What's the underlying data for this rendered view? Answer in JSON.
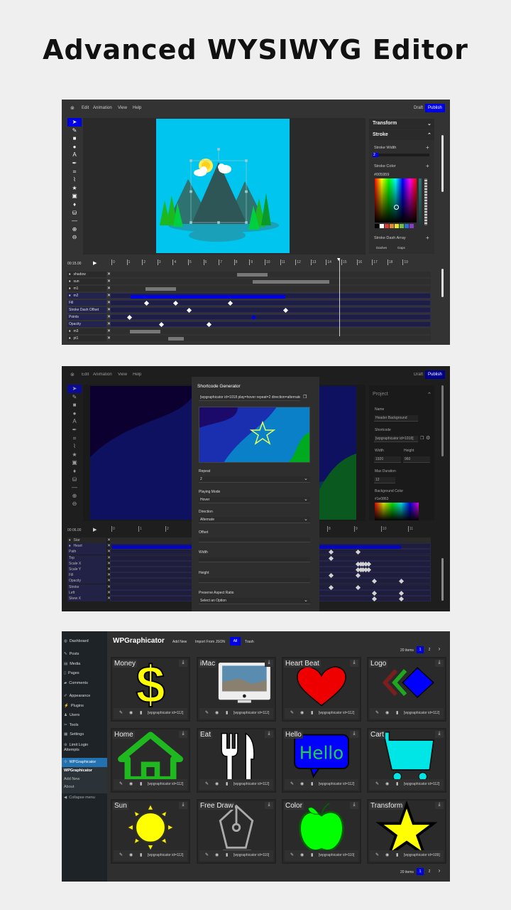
{
  "hero_title": "Advanced WYSIWYG Editor",
  "colors": {
    "accent": "#0000e6",
    "artboard1": "#00c5ee",
    "wp_sidebar": "#1d2327",
    "wp_active": "#2271b1"
  },
  "editor1": {
    "menu": [
      "Edit",
      "Animation",
      "View",
      "Help"
    ],
    "draft": "Draft",
    "publish": "Publish",
    "tools": [
      "select-icon",
      "pencil-icon",
      "rectangle-icon",
      "circle-icon",
      "text-icon",
      "pen-icon",
      "crop-icon",
      "path-icon",
      "star-icon",
      "image-icon",
      "drop-icon",
      "paint-bucket-icon",
      "line-icon",
      "zoom-in-icon",
      "zoom-out-icon"
    ],
    "panel": {
      "transform": "Transform",
      "stroke": "Stroke",
      "stroke_width_label": "Stroke Width",
      "stroke_width_value": "2",
      "stroke_color_label": "Stroke Color",
      "stroke_color_value": "#005959",
      "swatches": [
        "#000000",
        "#ffffff",
        "#d63a3a",
        "#e08a2a",
        "#e8e030",
        "#6ac040",
        "#2a70d0",
        "#8a3ad0"
      ],
      "stroke_dash_label": "Stroke Dash Array",
      "dashes": "Dashes",
      "gaps": "Gaps"
    },
    "timeline": {
      "time": "00:15.00",
      "ticks": [
        "0",
        "1",
        "2",
        "3",
        "4",
        "5",
        "6",
        "7",
        "8",
        "9",
        "10",
        "11",
        "12",
        "13",
        "14",
        "15",
        "16",
        "17",
        "18",
        "19"
      ],
      "playhead": 14.8,
      "rows": [
        {
          "name": "shadow",
          "layer": true,
          "bars": [
            [
              8.2,
              10.2
            ]
          ]
        },
        {
          "name": "sun",
          "layer": true,
          "bars": [
            [
              9.2,
              14.2
            ]
          ]
        },
        {
          "name": "m1",
          "layer": true,
          "bars": [
            [
              2.2,
              4.2
            ]
          ]
        },
        {
          "name": "m2",
          "layer": true,
          "selected": true,
          "bars": [
            [
              1.2,
              11.3
            ]
          ],
          "bar_color": "#0000e6"
        },
        {
          "name": "Fill",
          "prop": true,
          "keys": [
            2.2,
            4.1,
            7.7
          ]
        },
        {
          "name": "Stroke Dash Offset",
          "prop": true,
          "keys": [
            5.0,
            11.3
          ]
        },
        {
          "name": "Points",
          "prop": true,
          "keys": [
            1.1,
            9.2
          ],
          "active_key": 9.2
        },
        {
          "name": "Opacity",
          "prop": true,
          "keys": [
            3.2,
            6.3
          ]
        },
        {
          "name": "m3",
          "layer": true,
          "bars": [
            [
              1.2,
              3.2
            ]
          ]
        },
        {
          "name": "pt1",
          "layer": true,
          "bars": [
            [
              3.7,
              4.7
            ]
          ]
        }
      ]
    }
  },
  "editor2": {
    "menu": [
      "Edit",
      "Animation",
      "View",
      "Help"
    ],
    "draft": "Draft",
    "publish": "Publish",
    "modal": {
      "title": "Shortcode Generator",
      "shortcode": "[wpgraphicator id=1018 play=hover repeat=2 direction=alternate]",
      "repeat_label": "Repeat",
      "repeat_value": "2",
      "mode_label": "Playing Mode",
      "mode_value": "Hover",
      "direction_label": "Direction",
      "direction_value": "Alternate",
      "offset_label": "Offset",
      "width_label": "Width",
      "height_label": "Height",
      "aspect_label": "Preserve Aspect Ratio",
      "aspect_value": "Select an Option"
    },
    "project": {
      "title": "Project",
      "name_label": "Name",
      "name_value": "Header Background",
      "shortcode_label": "Shortcode",
      "shortcode_value": "[wpgraphicator id=1018]",
      "width_label": "Width",
      "width_value": "1920",
      "height_label": "Height",
      "height_value": "960",
      "duration_label": "Max Duration",
      "duration_value": "12",
      "bg_label": "Background Color",
      "bg_value": "#1e0863"
    },
    "timeline": {
      "time": "00:06.00",
      "ticks": [
        "0",
        "1",
        "2",
        "3",
        "4",
        "5",
        "6",
        "7",
        "8",
        "9",
        "10",
        "11"
      ],
      "rows": [
        {
          "name": "Star",
          "layer": true
        },
        {
          "name": "Heart",
          "layer": true,
          "selected": true,
          "bars": [
            [
              0,
              10.7
            ]
          ],
          "bar_color": "#0000e6"
        },
        {
          "name": "Path",
          "prop": true,
          "keys": [
            8.1,
            9.1
          ]
        },
        {
          "name": "Top",
          "prop": true,
          "keys": [
            8.1
          ]
        },
        {
          "name": "Scale X",
          "prop": true,
          "keys": [
            9.1,
            9.2,
            9.3,
            9.4,
            9.5
          ]
        },
        {
          "name": "Scale Y",
          "prop": true,
          "keys": [
            9.1,
            9.2,
            9.3,
            9.4,
            9.5
          ]
        },
        {
          "name": "Fill",
          "prop": true,
          "keys": [
            8.1,
            9.1
          ]
        },
        {
          "name": "Opacity",
          "prop": true,
          "keys": [
            9.7,
            10.7
          ]
        },
        {
          "name": "Stroke",
          "prop": true,
          "keys": [
            8.1,
            9.1
          ]
        },
        {
          "name": "Left",
          "prop": true,
          "keys": [
            9.7,
            10.7
          ]
        },
        {
          "name": "Skew X",
          "prop": true,
          "keys": [
            9.7,
            10.7
          ]
        }
      ]
    }
  },
  "wp": {
    "menu": [
      {
        "label": "Dashboard",
        "icon": "dashboard-icon"
      },
      {
        "label": "Posts",
        "icon": "pin-icon"
      },
      {
        "label": "Media",
        "icon": "media-icon"
      },
      {
        "label": "Pages",
        "icon": "pages-icon"
      },
      {
        "label": "Comments",
        "icon": "comment-icon"
      },
      {
        "label": "Appearance",
        "icon": "brush-icon"
      },
      {
        "label": "Plugins",
        "icon": "plugin-icon"
      },
      {
        "label": "Users",
        "icon": "user-icon"
      },
      {
        "label": "Tools",
        "icon": "wrench-icon"
      },
      {
        "label": "Settings",
        "icon": "settings-icon"
      },
      {
        "label": "Limit Login Attempts",
        "icon": "lock-icon"
      },
      {
        "label": "WPGraphicator",
        "icon": "graphicator-icon",
        "active": true
      }
    ],
    "submenu": [
      "WPGraphicator",
      "Add New",
      "About"
    ],
    "collapse": "Collapse menu",
    "title": "WPGraphicator",
    "actions": [
      "Add New",
      "Import From JSON"
    ],
    "filters": [
      "All",
      "Trash"
    ],
    "items_count": "20 items",
    "pages": [
      "1",
      "2"
    ],
    "next": "›",
    "cards": [
      {
        "title": "Money",
        "icon": "dollar",
        "shortcode": "[wpgraphicator id=112]"
      },
      {
        "title": "iMac",
        "icon": "imac",
        "shortcode": "[wpgraphicator id=112]"
      },
      {
        "title": "Heart Beat",
        "icon": "heart",
        "shortcode": "[wpgraphicator id=112]"
      },
      {
        "title": "Logo",
        "icon": "logo",
        "shortcode": "[wpgraphicator id=112]"
      },
      {
        "title": "Home",
        "icon": "house",
        "shortcode": "[wpgraphicator id=112]"
      },
      {
        "title": "Eat",
        "icon": "fork-knife",
        "shortcode": "[wpgraphicator id=112]"
      },
      {
        "title": "Hello",
        "icon": "hello-bubble",
        "shortcode": "[wpgraphicator id=112]",
        "image_text": "Hello"
      },
      {
        "title": "Cart",
        "icon": "cart",
        "shortcode": "[wpgraphicator id=112]"
      },
      {
        "title": "Sun",
        "icon": "sun",
        "shortcode": "[wpgraphicator id=112]"
      },
      {
        "title": "Free Draw",
        "icon": "pen-nib",
        "shortcode": "[wpgraphicator id=110]"
      },
      {
        "title": "Color",
        "icon": "apple",
        "shortcode": "[wpgraphicator id=110]"
      },
      {
        "title": "Transform",
        "icon": "star",
        "shortcode": "[wpgraphicator id=109]"
      }
    ]
  }
}
